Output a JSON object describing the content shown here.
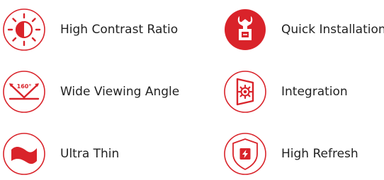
{
  "accent_color": "#d9232a",
  "text_color": "#222222",
  "features": [
    {
      "label": "High Contrast Ratio",
      "icon": "contrast-sun-icon"
    },
    {
      "label": "Wide Viewing Angle",
      "icon": "viewing-angle-icon",
      "icon_text": "160°"
    },
    {
      "label": "Ultra Thin",
      "icon": "ultra-thin-icon"
    },
    {
      "label": "Quick Installation",
      "icon": "installation-icon"
    },
    {
      "label": "Integration",
      "icon": "integration-icon"
    },
    {
      "label": "High Refresh",
      "icon": "refresh-shield-icon"
    }
  ]
}
